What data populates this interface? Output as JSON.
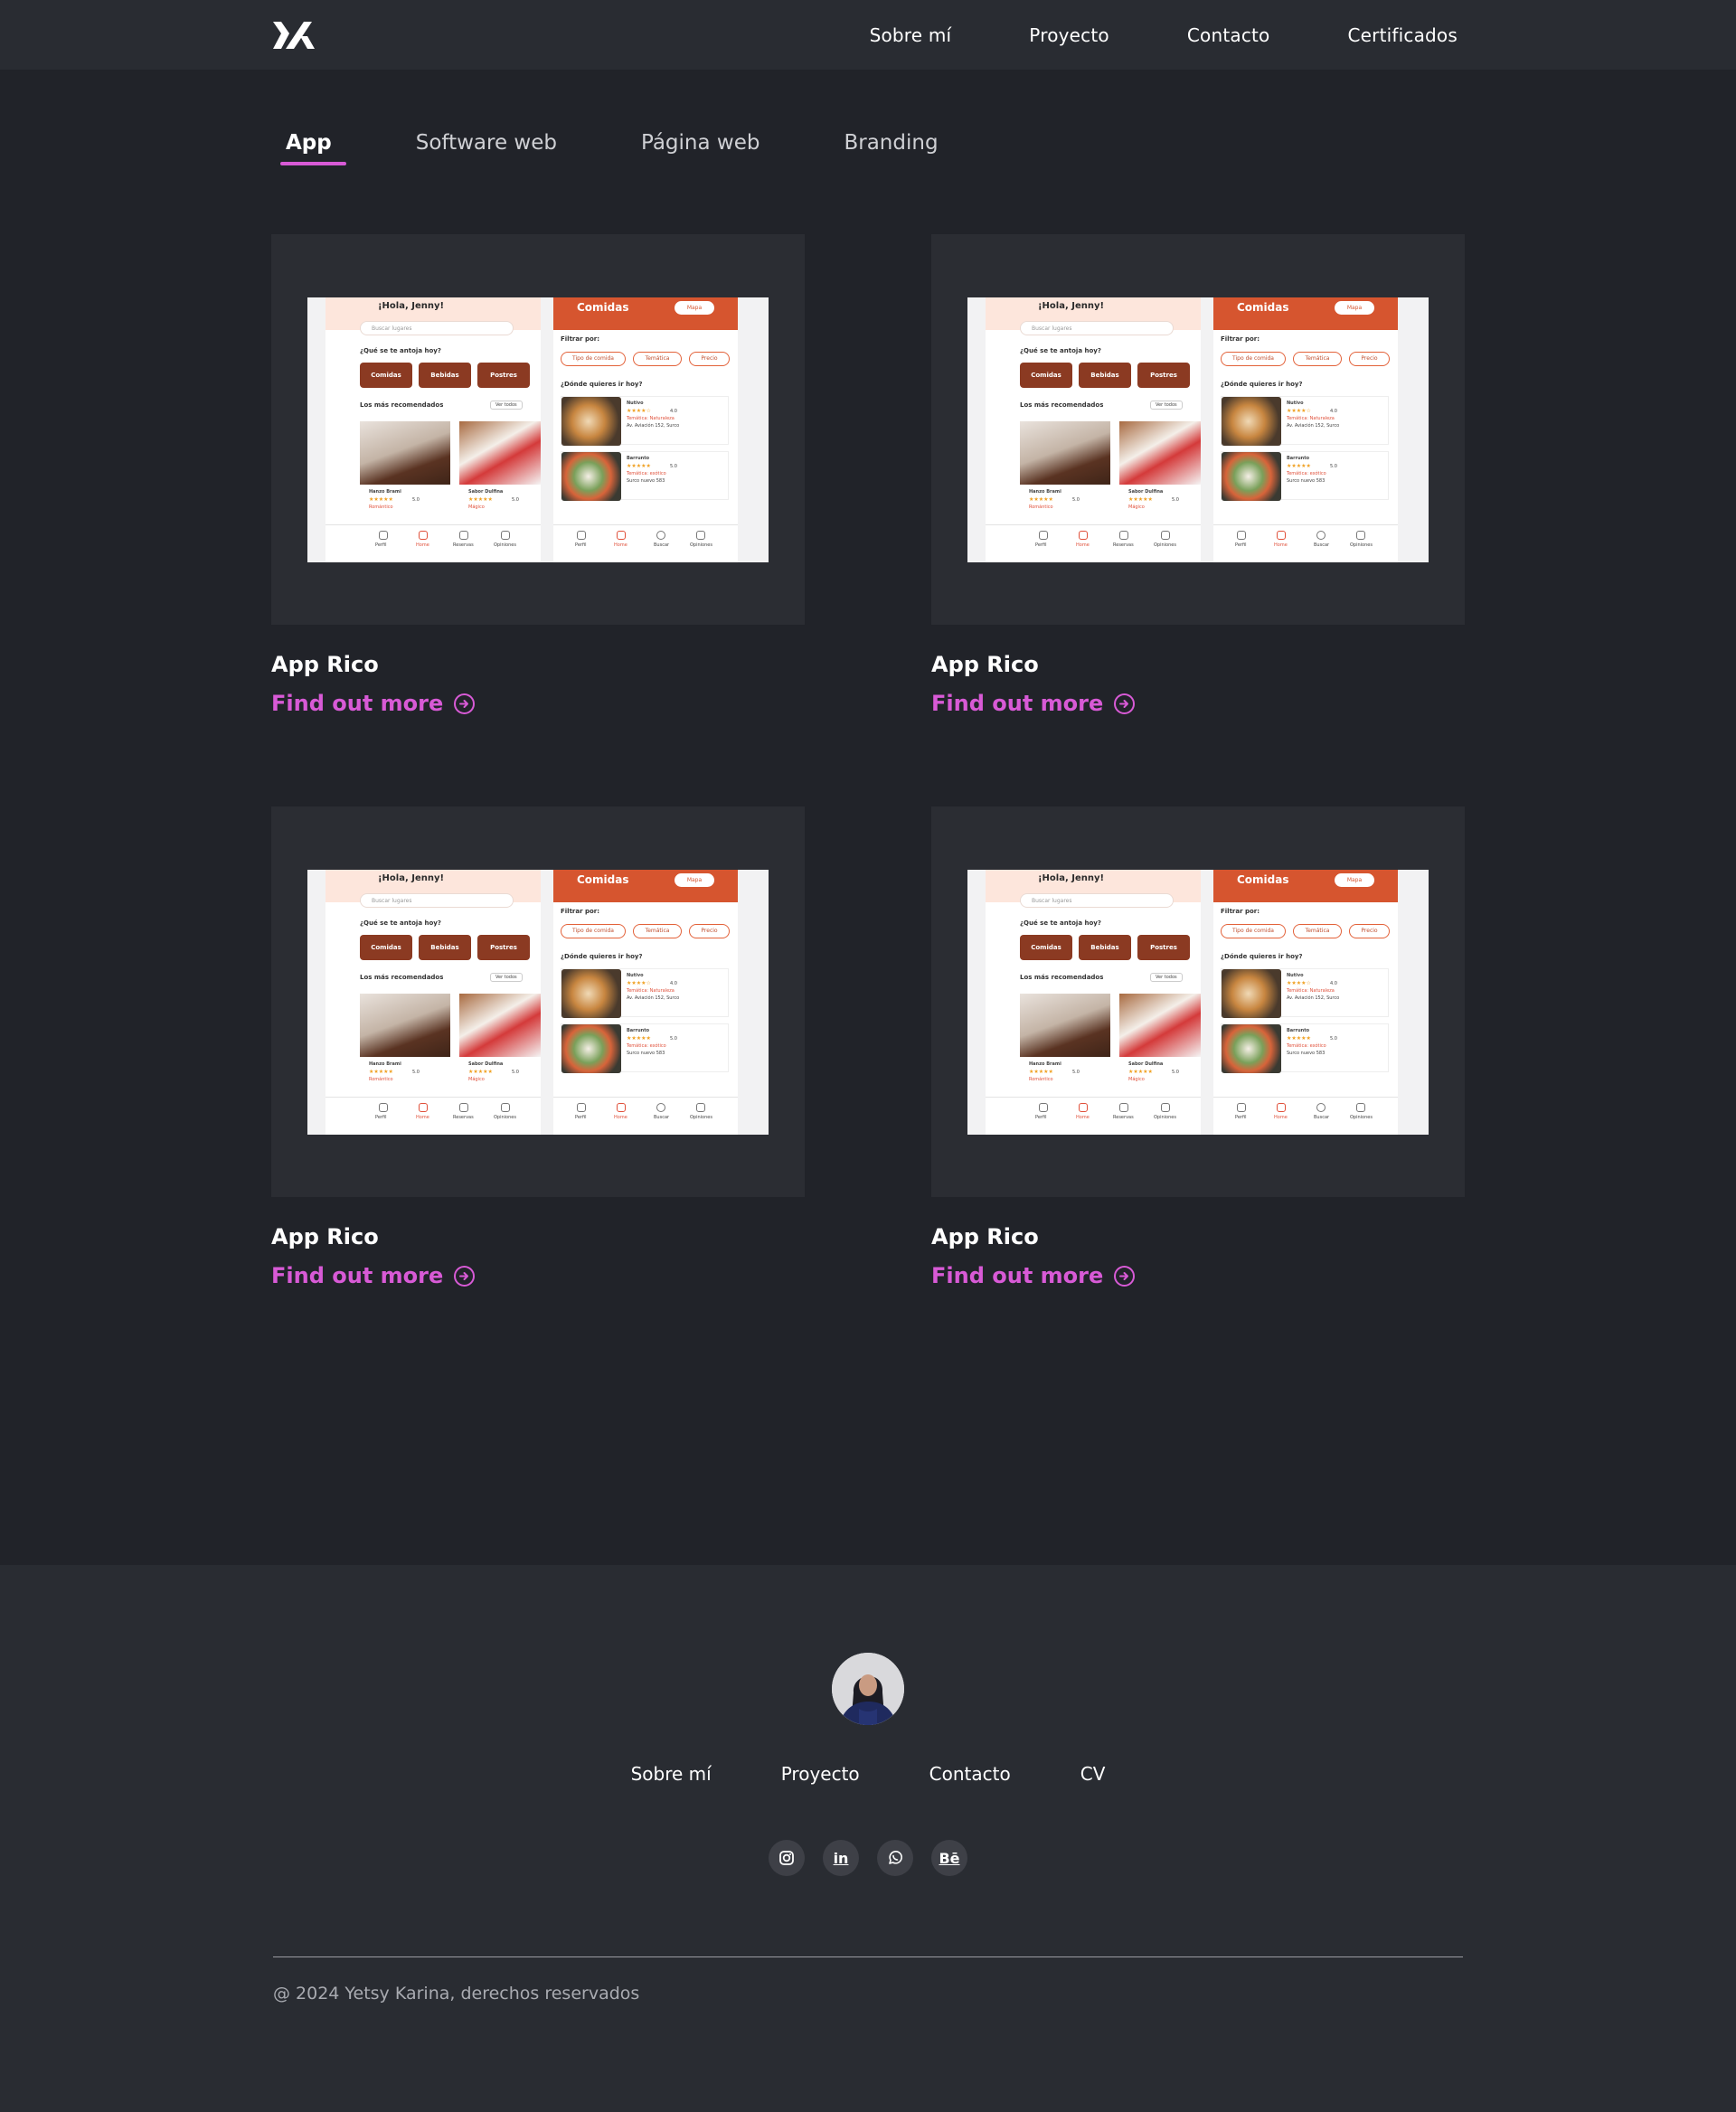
{
  "brand": {
    "logo_icon": "yk-monogram-logo"
  },
  "topnav": {
    "items": [
      {
        "label": "Sobre mí"
      },
      {
        "label": "Proyecto"
      },
      {
        "label": "Contacto"
      },
      {
        "label": "Certificados"
      }
    ]
  },
  "tabs": [
    {
      "label": "App",
      "active": true
    },
    {
      "label": "Software web",
      "active": false
    },
    {
      "label": "Página web",
      "active": false
    },
    {
      "label": "Branding",
      "active": false
    }
  ],
  "projects": [
    {
      "title": "App Rico",
      "link_label": "Find out more"
    },
    {
      "title": "App Rico",
      "link_label": "Find out more"
    },
    {
      "title": "App Rico",
      "link_label": "Find out more"
    },
    {
      "title": "App Rico",
      "link_label": "Find out more"
    }
  ],
  "mockup": {
    "greeting": "¡Hola, Jenny!",
    "search_placeholder": "Buscar lugares",
    "craving_label": "¿Qué se te antoja hoy?",
    "categories": [
      "Comidas",
      "Bebidas",
      "Postres"
    ],
    "recommended_label": "Los más recomendados",
    "see_all": "Ver todos",
    "rec_items": [
      {
        "name": "Hanzo Brami",
        "rating": "5.0",
        "tag": "Romántico"
      },
      {
        "name": "Sabor Dulfina",
        "rating": "5.0",
        "tag": "Mágico"
      }
    ],
    "screen2_title": "Comidas",
    "map_label": "Mapa",
    "filter_label": "Filtrar por:",
    "filters": [
      "Tipo de comida",
      "Temática",
      "Precio"
    ],
    "where_label": "¿Dónde quieres ir hoy?",
    "places": [
      {
        "name": "Nutivo",
        "rating": "4.0",
        "theme": "Temática: Naturaleza",
        "address": "Av. Aviación 152, Surco"
      },
      {
        "name": "Barrunto",
        "rating": "5.0",
        "theme": "Temática: exótico",
        "address": "Surco nuevo 583"
      }
    ],
    "tabbar": [
      "Perfil",
      "Home",
      "Reservas",
      "Opiniones"
    ],
    "tabbar2": [
      "Perfil",
      "Home",
      "Buscar",
      "Opiniones"
    ]
  },
  "footer": {
    "avatar_icon": "profile-avatar",
    "nav": [
      {
        "label": "Sobre mí"
      },
      {
        "label": "Proyecto"
      },
      {
        "label": "Contacto"
      },
      {
        "label": "CV"
      }
    ],
    "social": [
      {
        "icon": "instagram-icon"
      },
      {
        "icon": "linkedin-icon",
        "text": "in"
      },
      {
        "icon": "whatsapp-icon"
      },
      {
        "icon": "behance-icon",
        "text": "Bē"
      }
    ],
    "copyright": "@ 2024 Yetsy Karina, derechos reservados"
  },
  "colors": {
    "background": "#212329",
    "header_footer": "#292c32",
    "card": "#2b2d33",
    "accent": "#d85ad6"
  }
}
